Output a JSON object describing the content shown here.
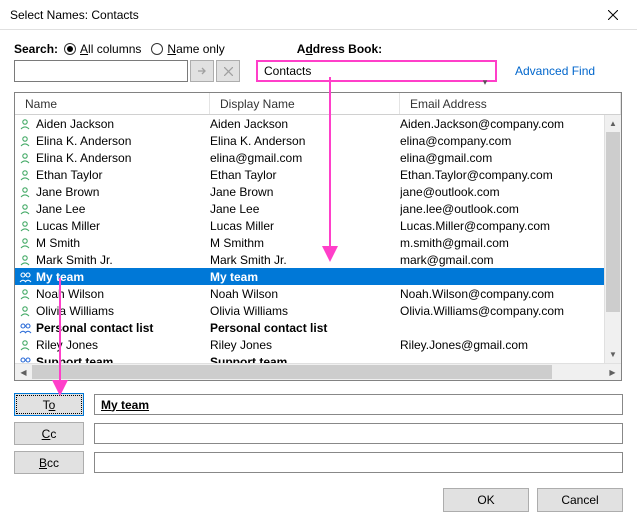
{
  "dialog": {
    "title": "Select Names: Contacts"
  },
  "search": {
    "label": "Search:",
    "radio_all": "All columns",
    "radio_name": "Name only",
    "value": ""
  },
  "addressBook": {
    "label": "Address Book:",
    "selected": "Contacts"
  },
  "advancedFind": "Advanced Find",
  "columns": {
    "name": "Name",
    "display": "Display Name",
    "email": "Email Address"
  },
  "rows": [
    {
      "icon": "person",
      "name": "Aiden Jackson",
      "display": "Aiden Jackson",
      "email": "Aiden.Jackson@company.com",
      "selected": false,
      "bold": false
    },
    {
      "icon": "person",
      "name": "Elina K. Anderson",
      "display": "Elina K. Anderson",
      "email": "elina@company.com",
      "selected": false,
      "bold": false
    },
    {
      "icon": "person",
      "name": "Elina K. Anderson",
      "display": "elina@gmail.com",
      "email": "elina@gmail.com",
      "selected": false,
      "bold": false
    },
    {
      "icon": "person",
      "name": "Ethan Taylor",
      "display": "Ethan Taylor",
      "email": "Ethan.Taylor@company.com",
      "selected": false,
      "bold": false
    },
    {
      "icon": "person",
      "name": "Jane Brown",
      "display": "Jane Brown",
      "email": "jane@outlook.com",
      "selected": false,
      "bold": false
    },
    {
      "icon": "person",
      "name": "Jane Lee",
      "display": "Jane Lee",
      "email": "jane.lee@outlook.com",
      "selected": false,
      "bold": false
    },
    {
      "icon": "person",
      "name": "Lucas Miller",
      "display": "Lucas Miller",
      "email": "Lucas.Miller@company.com",
      "selected": false,
      "bold": false
    },
    {
      "icon": "person",
      "name": "M Smith",
      "display": "M Smithm",
      "email": "m.smith@gmail.com",
      "selected": false,
      "bold": false
    },
    {
      "icon": "person",
      "name": "Mark Smith Jr.",
      "display": "Mark Smith Jr.",
      "email": "mark@gmail.com",
      "selected": false,
      "bold": false
    },
    {
      "icon": "group",
      "name": "My team",
      "display": "My team",
      "email": "",
      "selected": true,
      "bold": true
    },
    {
      "icon": "person",
      "name": "Noah Wilson",
      "display": "Noah Wilson",
      "email": "Noah.Wilson@company.com",
      "selected": false,
      "bold": false
    },
    {
      "icon": "person",
      "name": "Olivia Williams",
      "display": "Olivia Williams",
      "email": "Olivia.Williams@company.com",
      "selected": false,
      "bold": false
    },
    {
      "icon": "group",
      "name": "Personal contact list",
      "display": "Personal contact list",
      "email": "",
      "selected": false,
      "bold": true
    },
    {
      "icon": "person",
      "name": "Riley Jones",
      "display": "Riley Jones",
      "email": "Riley.Jones@gmail.com",
      "selected": false,
      "bold": false
    },
    {
      "icon": "group",
      "name": "Support team",
      "display": "Support team",
      "email": "",
      "selected": false,
      "bold": true
    }
  ],
  "fields": {
    "to_label": "To",
    "to_value": "My team",
    "cc_label": "Cc",
    "cc_value": "",
    "bcc_label": "Bcc",
    "bcc_value": ""
  },
  "buttons": {
    "ok": "OK",
    "cancel": "Cancel"
  },
  "colors": {
    "selection": "#0078d7",
    "annotation": "#ff3fc9"
  }
}
